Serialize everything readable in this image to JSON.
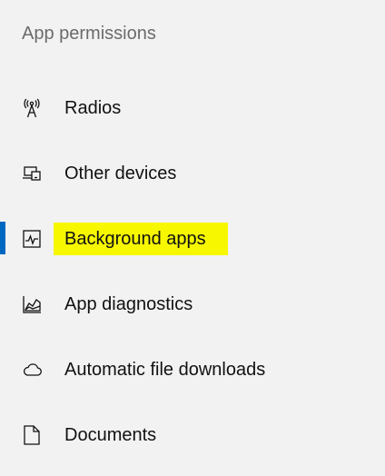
{
  "section": {
    "title": "App permissions"
  },
  "nav": {
    "items": [
      {
        "label": "Radios",
        "icon": "radio-tower-icon"
      },
      {
        "label": "Other devices",
        "icon": "devices-icon"
      },
      {
        "label": "Background apps",
        "icon": "background-apps-icon",
        "selected": true
      },
      {
        "label": "App diagnostics",
        "icon": "diagnostics-chart-icon"
      },
      {
        "label": "Automatic file downloads",
        "icon": "cloud-icon"
      },
      {
        "label": "Documents",
        "icon": "document-icon"
      }
    ]
  },
  "colors": {
    "background": "#f2f2f2",
    "accent": "#0067c0",
    "highlight": "#f7f700",
    "header_text": "#6b6b6b"
  }
}
